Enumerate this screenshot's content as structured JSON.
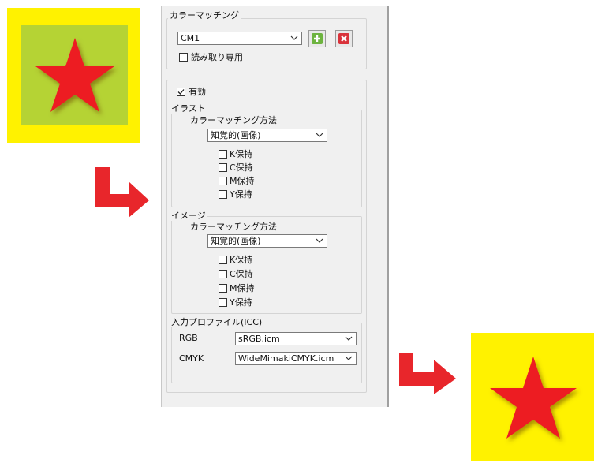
{
  "color_matching": {
    "group_label": "カラーマッチング",
    "profile_value": "CM1",
    "add_icon": "plus-icon",
    "delete_icon": "x-icon",
    "readonly_label": "読み取り専用",
    "readonly_checked": false
  },
  "enabled": {
    "label": "有効",
    "checked": true
  },
  "illust": {
    "group_label": "イラスト",
    "method_label": "カラーマッチング方法",
    "method_value": "知覚的(画像)",
    "options": [
      {
        "label": "K保持",
        "checked": false
      },
      {
        "label": "C保持",
        "checked": false
      },
      {
        "label": "M保持",
        "checked": false
      },
      {
        "label": "Y保持",
        "checked": false
      }
    ]
  },
  "image": {
    "group_label": "イメージ",
    "method_label": "カラーマッチング方法",
    "method_value": "知覚的(画像)",
    "options": [
      {
        "label": "K保持",
        "checked": false
      },
      {
        "label": "C保持",
        "checked": false
      },
      {
        "label": "M保持",
        "checked": false
      },
      {
        "label": "Y保持",
        "checked": false
      }
    ]
  },
  "input_profile": {
    "group_label": "入力プロファイル(ICC)",
    "rgb_label": "RGB",
    "rgb_value": "sRGB.icm",
    "cmyk_label": "CMYK",
    "cmyk_value": "WideMimakiCMYK.icm"
  },
  "colors": {
    "yellow": "#fff200",
    "green": "#b5d334",
    "star_red": "#ed1c24",
    "arrow_red": "#e8262b"
  }
}
